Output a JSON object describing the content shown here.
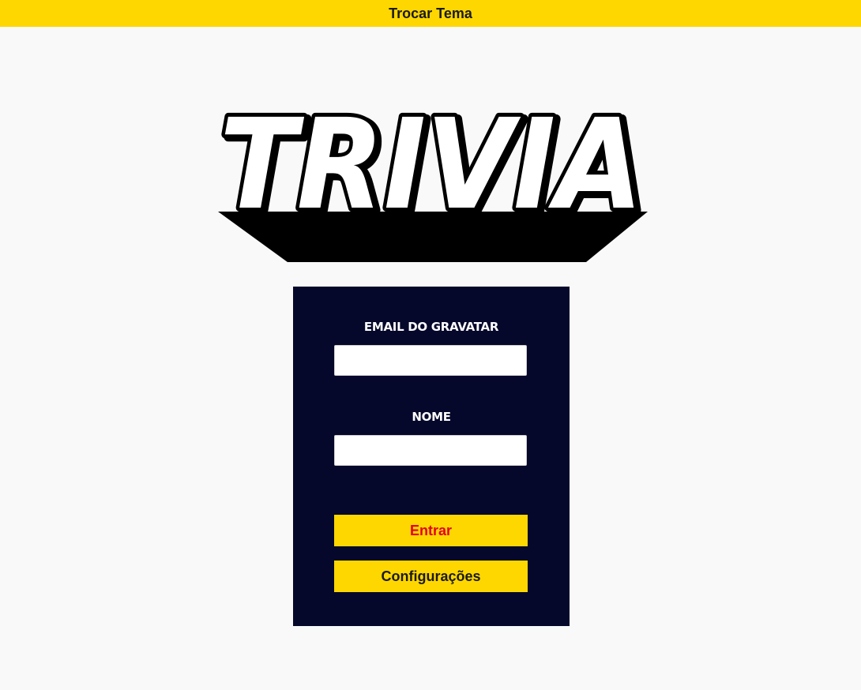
{
  "header": {
    "theme_button_label": "Trocar Tema"
  },
  "logo": {
    "text": "TRIVIA"
  },
  "login": {
    "email_label": "EMAIL DO GRAVATAR",
    "email_value": "",
    "name_label": "NOME",
    "name_value": "",
    "enter_label": "Entrar",
    "settings_label": "Configurações"
  },
  "colors": {
    "accent_yellow": "#ffd700",
    "card_navy": "#05082b",
    "page_background": "#f9f9f9",
    "enter_text_red": "#e4001b"
  }
}
